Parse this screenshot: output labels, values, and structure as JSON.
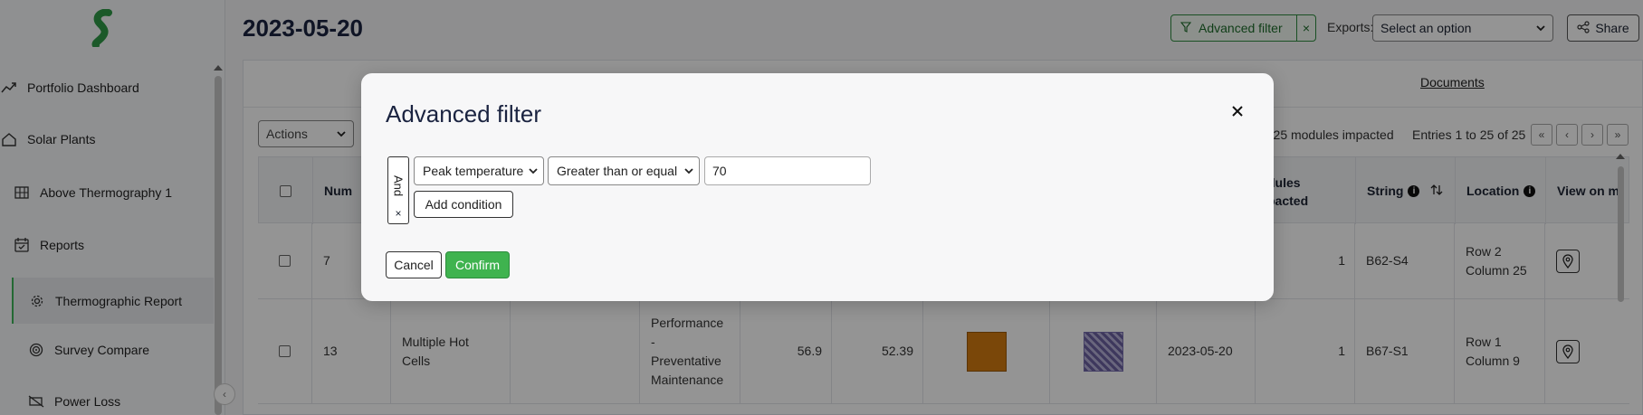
{
  "sidebar": {
    "items": [
      {
        "label": "Portfolio Dashboard",
        "icon": "trend-chart-icon"
      },
      {
        "label": "Solar Plants",
        "icon": "home-icon"
      },
      {
        "label": "Above Thermography 1",
        "icon": "solar-panel-icon"
      },
      {
        "label": "Reports",
        "icon": "calendar-check-icon"
      },
      {
        "label": "Thermographic Report",
        "icon": "gear-icon"
      },
      {
        "label": "Survey Compare",
        "icon": "target-icon"
      },
      {
        "label": "Power Loss",
        "icon": "power-off-icon"
      }
    ]
  },
  "header": {
    "title": "2023-05-20",
    "advanced_filter_label": "Advanced filter",
    "advanced_filter_clear": "×",
    "exports_label": "Exports:",
    "exports_value": "Select an option",
    "share_label": "Share"
  },
  "tabs": {
    "documents": "Documents"
  },
  "toolbar": {
    "actions_value": "Actions",
    "modules_impacted": "| 25 modules impacted",
    "entries": "Entries 1 to 25 of 25",
    "pager": [
      "«",
      "‹",
      "›",
      "»"
    ]
  },
  "table": {
    "headers": {
      "num": "Num",
      "modules_l1": "dules",
      "modules_l2": "pacted",
      "string": "String",
      "location": "Location",
      "view_on_map": "View on m"
    },
    "rows": [
      {
        "num": "7",
        "name": "",
        "severity": "",
        "peak": "",
        "delta": "",
        "date": "",
        "modules": "1",
        "string": "B62-S4",
        "location_l1": "Row 2",
        "location_l2": "Column 25"
      },
      {
        "num": "13",
        "name_l1": "Multiple Hot",
        "name_l2": "Cells",
        "category_l1": "Performance",
        "category_l2": "-",
        "category_l3": "Preventative",
        "category_l4": "Maintenance",
        "peak": "56.9",
        "delta": "52.39",
        "date": "2023-05-20",
        "modules": "1",
        "string": "B67-S1",
        "location_l1": "Row 1",
        "location_l2": "Column 9"
      }
    ]
  },
  "modal": {
    "title": "Advanced filter",
    "close": "×",
    "group_operator": "And",
    "group_remove": "×",
    "condition": {
      "field": "Peak temperature",
      "operator": "Greater than or equal",
      "value": "70"
    },
    "add_condition_label": "Add condition",
    "cancel_label": "Cancel",
    "confirm_label": "Confirm"
  },
  "colors": {
    "accent": "#3fb34f",
    "title": "#1a2340",
    "overlay": "rgba(0,0,0,0.42)"
  }
}
